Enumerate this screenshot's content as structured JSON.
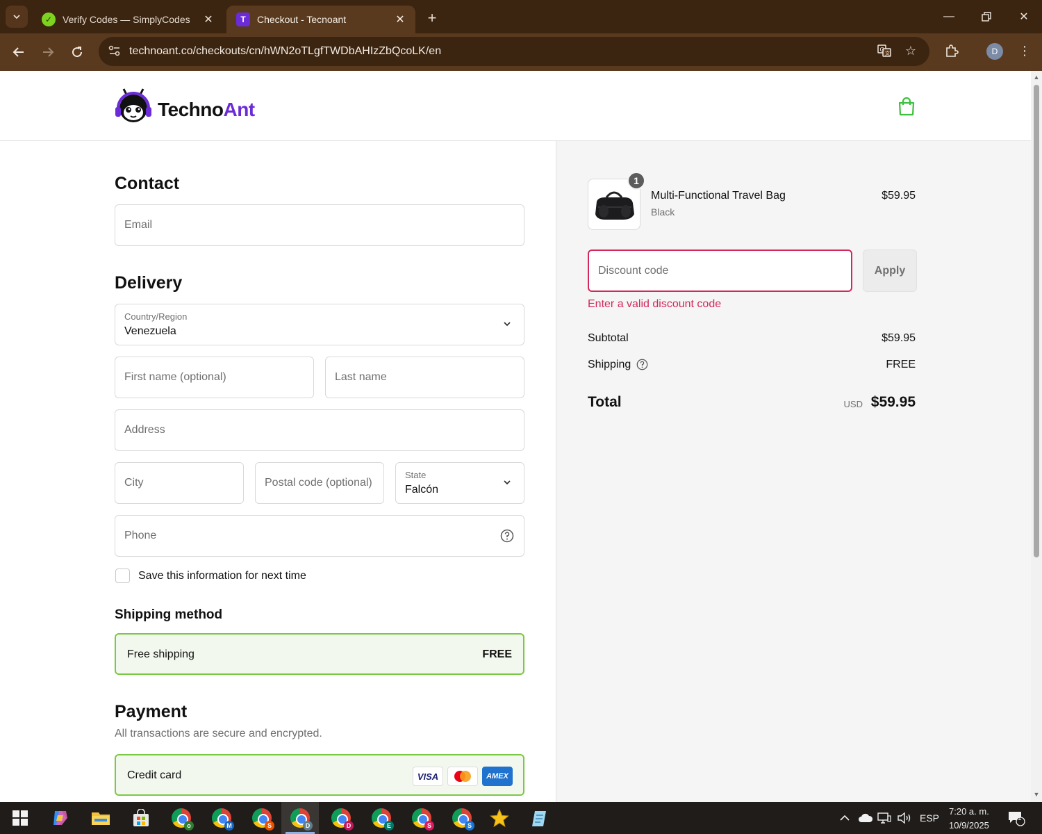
{
  "browser": {
    "tabs": [
      {
        "title": "Verify Codes — SimplyCodes",
        "favicon": "simplycodes-icon",
        "active": false
      },
      {
        "title": "Checkout - Tecnoant",
        "favicon": "T",
        "active": true
      }
    ],
    "url": "technoant.co/checkouts/cn/hWN2oTLgfTWDbAHIzZbQcoLK/en",
    "profile_initial": "D"
  },
  "store": {
    "name_part1": "Techno",
    "name_part2": "Ant",
    "accent_color": "#6b2bd9",
    "cart_icon_color": "#3fbf3f"
  },
  "contact": {
    "heading": "Contact",
    "email_placeholder": "Email"
  },
  "delivery": {
    "heading": "Delivery",
    "country_label": "Country/Region",
    "country_value": "Venezuela",
    "first_name_placeholder": "First name (optional)",
    "last_name_placeholder": "Last name",
    "address_placeholder": "Address",
    "city_placeholder": "City",
    "postal_placeholder": "Postal code (optional)",
    "state_label": "State",
    "state_value": "Falcón",
    "phone_placeholder": "Phone",
    "save_info_label": "Save this information for next time",
    "save_info_checked": false
  },
  "shipping_method": {
    "heading": "Shipping method",
    "option_label": "Free shipping",
    "option_price": "FREE"
  },
  "payment": {
    "heading": "Payment",
    "note": "All transactions are secure and encrypted.",
    "method_label": "Credit card",
    "card_brands": [
      "VISA",
      "mastercard",
      "AMEX"
    ]
  },
  "summary": {
    "item": {
      "quantity": "1",
      "name": "Multi-Functional Travel Bag",
      "variant": "Black",
      "price": "$59.95"
    },
    "discount_placeholder": "Discount code",
    "apply_label": "Apply",
    "discount_error": "Enter a valid discount code",
    "error_color": "#d2285b",
    "subtotal_label": "Subtotal",
    "subtotal_value": "$59.95",
    "shipping_label": "Shipping",
    "shipping_value": "FREE",
    "total_label": "Total",
    "total_currency": "USD",
    "total_value": "$59.95"
  },
  "taskbar": {
    "apps": [
      "windows-start-icon",
      "copilot-icon",
      "file-explorer-icon",
      "microsoft-store-icon",
      "chrome-profile-o-icon",
      "chrome-profile-m-icon",
      "chrome-profile-s-icon",
      "chrome-profile-d-icon",
      "chrome-profile-d2-icon",
      "chrome-profile-e-icon",
      "chrome-profile-s2-icon",
      "chrome-profile-s3-icon",
      "star-app-icon",
      "notepad-app-icon"
    ],
    "language": "ESP",
    "time": "7:20 a. m.",
    "date": "10/9/2025",
    "notification_count": "1"
  }
}
